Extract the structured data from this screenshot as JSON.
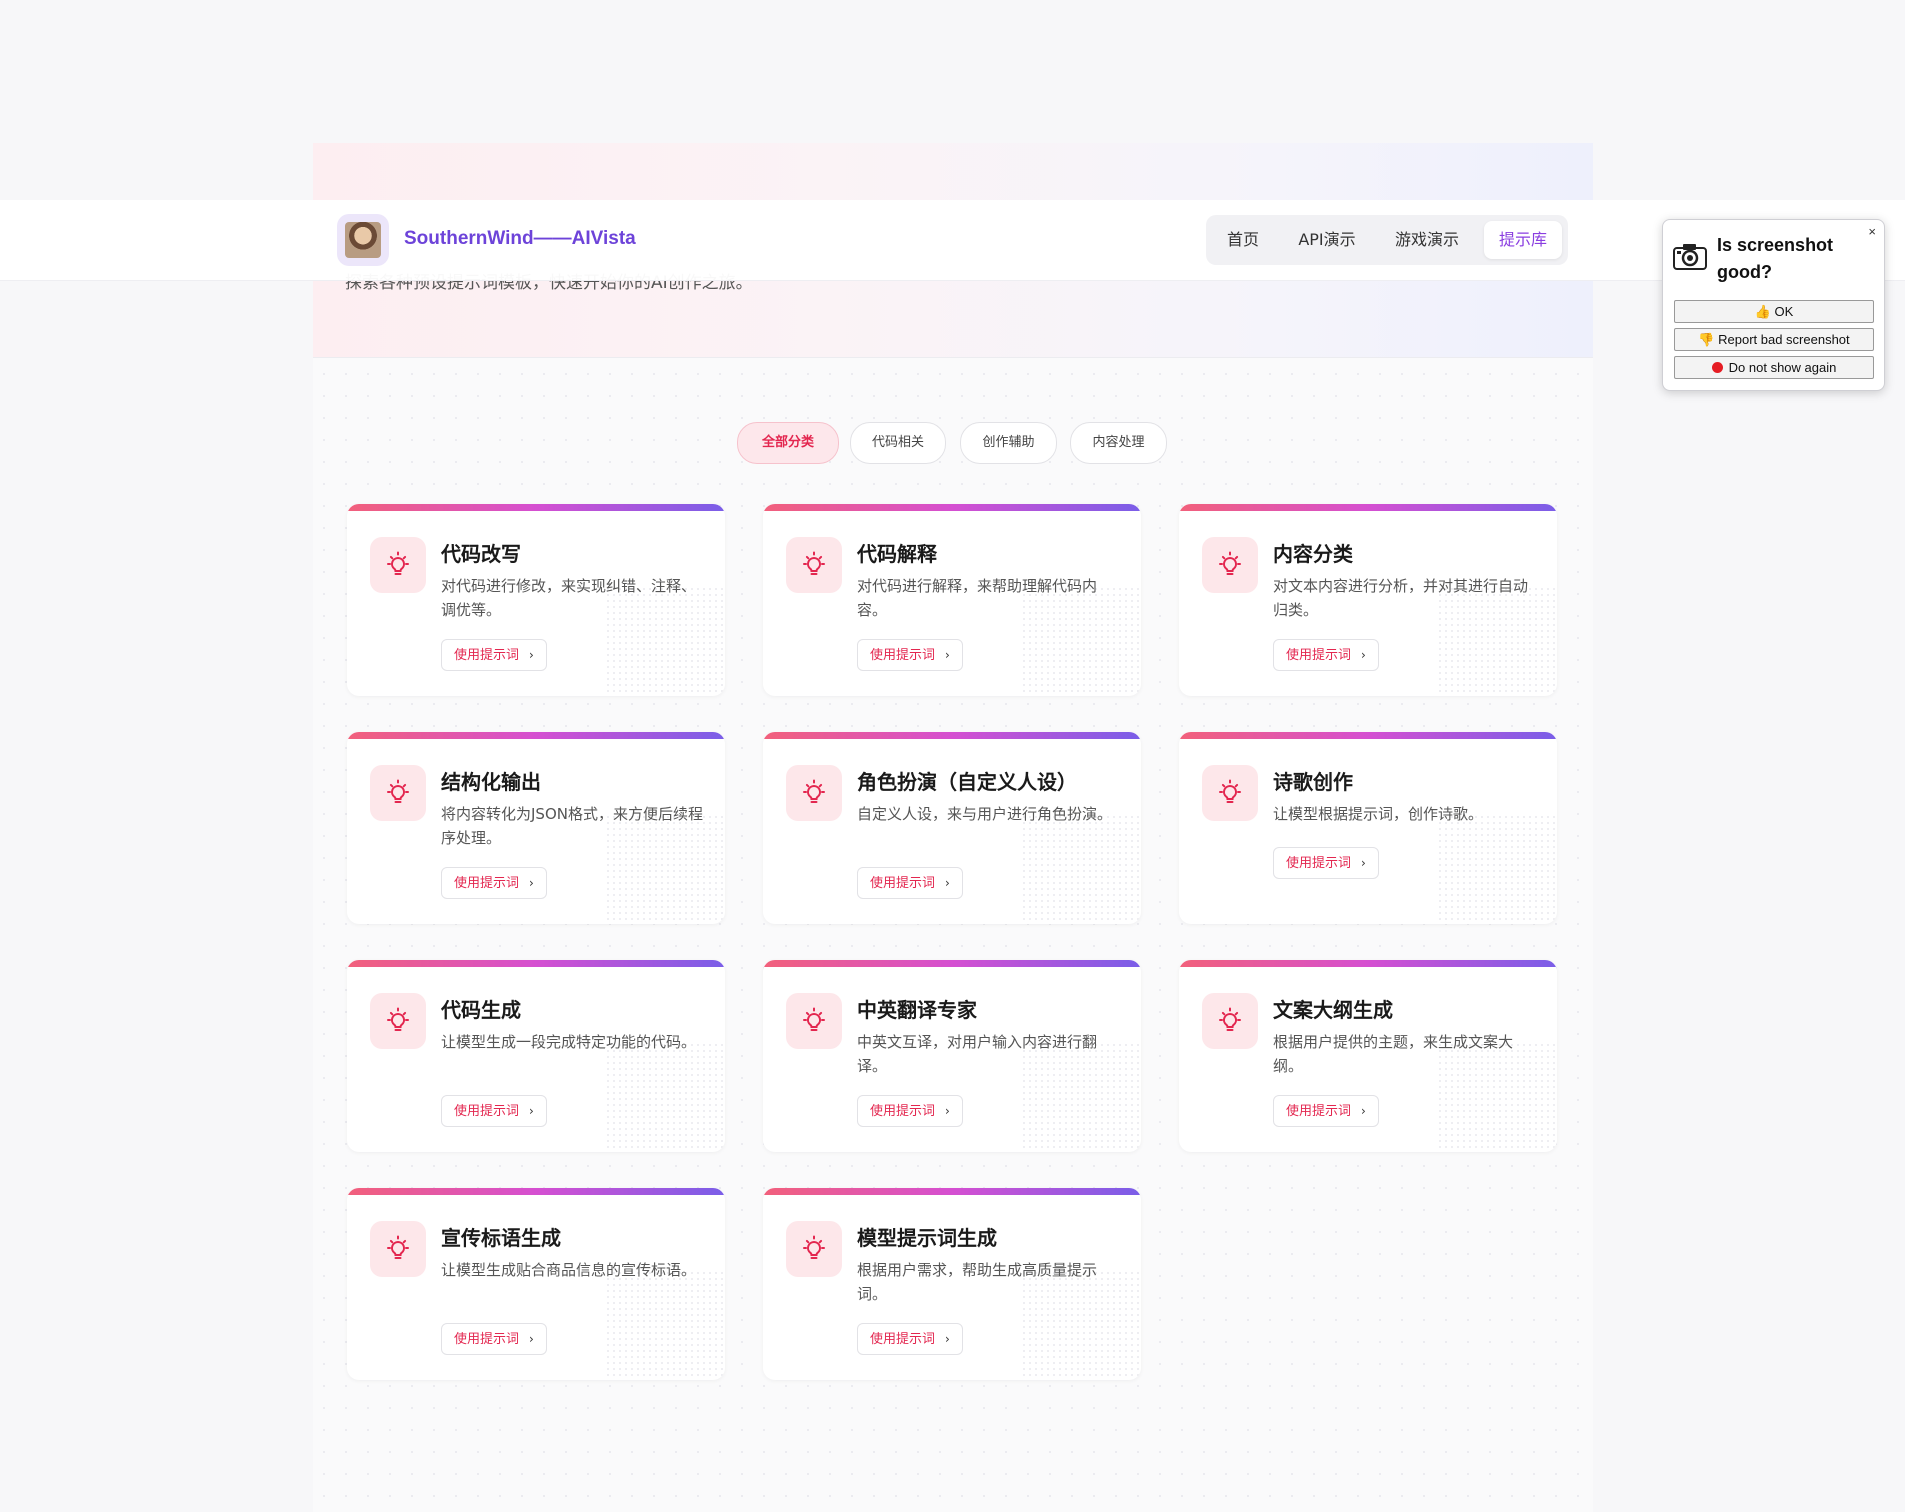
{
  "hero": {
    "subtitle": "探索各种预设提示词模板，快速开始你的AI创作之旅。"
  },
  "brand": {
    "name": "SouthernWind——AIVista"
  },
  "nav": {
    "items": [
      "首页",
      "API演示",
      "游戏演示",
      "提示库"
    ],
    "active_index": 3
  },
  "filters": {
    "items": [
      "全部分类",
      "代码相关",
      "创作辅助",
      "内容处理"
    ],
    "active_index": 0
  },
  "cards": [
    {
      "title": "代码改写",
      "desc": "对代码进行修改，来实现纠错、注释、调优等。",
      "button": "使用提示词"
    },
    {
      "title": "代码解释",
      "desc": "对代码进行解释，来帮助理解代码内容。",
      "button": "使用提示词"
    },
    {
      "title": "内容分类",
      "desc": "对文本内容进行分析，并对其进行自动归类。",
      "button": "使用提示词"
    },
    {
      "title": "结构化输出",
      "desc": "将内容转化为JSON格式，来方便后续程序处理。",
      "button": "使用提示词"
    },
    {
      "title": "角色扮演（自定义人设）",
      "desc": "自定义人设，来与用户进行角色扮演。",
      "button": "使用提示词"
    },
    {
      "title": "诗歌创作",
      "desc": "让模型根据提示词，创作诗歌。",
      "button": "使用提示词"
    },
    {
      "title": "代码生成",
      "desc": "让模型生成一段完成特定功能的代码。",
      "button": "使用提示词"
    },
    {
      "title": "中英翻译专家",
      "desc": "中英文互译，对用户输入内容进行翻译。",
      "button": "使用提示词"
    },
    {
      "title": "文案大纲生成",
      "desc": "根据用户提供的主题，来生成文案大纲。",
      "button": "使用提示词"
    },
    {
      "title": "宣传标语生成",
      "desc": "让模型生成贴合商品信息的宣传标语。",
      "button": "使用提示词"
    },
    {
      "title": "模型提示词生成",
      "desc": "根据用户需求，帮助生成高质量提示词。",
      "button": "使用提示词"
    }
  ],
  "popup": {
    "question": "Is screenshot good?",
    "ok": "👍 OK",
    "report": "👎 Report bad screenshot",
    "dont_show": "Do not show again",
    "close": "×"
  },
  "colors": {
    "accent": "#e3264f",
    "brand": "#6d43d9",
    "nav_active": "#8a3ee0"
  }
}
